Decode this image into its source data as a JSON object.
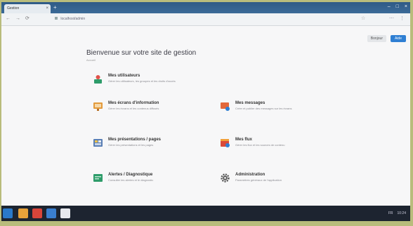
{
  "browser": {
    "tab_label": "Gestion",
    "tab_close": "×",
    "new_tab": "+",
    "window_controls": [
      "–",
      "□",
      "×"
    ],
    "nav": [
      "←",
      "→",
      "⟳"
    ],
    "url": "localhost/admin",
    "star": "☆",
    "addr_right": [
      "⋯",
      "⋮"
    ]
  },
  "header": {
    "buttons": [
      "Bonjour",
      "Aide"
    ]
  },
  "page": {
    "title": "Bienvenue sur votre site de gestion",
    "subtitle": "Accueil"
  },
  "cards": [
    {
      "title": "Mes utilisateurs",
      "desc": "Gérer les utilisateurs, les groupes et les droits d'accès",
      "icon": "user-icon",
      "color": "#2e9c6a"
    },
    {
      "title": "Mes écrans d'information",
      "desc": "Gérer les écrans et les contenus diffusés",
      "icon": "screen-icon",
      "color": "#e39a3b"
    },
    {
      "title": "Mes messages",
      "desc": "Créer et publier des messages sur les écrans",
      "icon": "message-icon",
      "color": "#e3683b"
    },
    {
      "title": "Mes présentations / pages",
      "desc": "Gérer les présentations et les pages",
      "icon": "presentation-icon",
      "color": "#5a7fb5"
    },
    {
      "title": "Mes flux",
      "desc": "Gérer les flux et les sources de contenu",
      "icon": "feed-icon",
      "color": "#d94a3a"
    },
    {
      "title": "Alertes / Diagnostique",
      "desc": "Consulter les alertes et le diagnostic",
      "icon": "alert-icon",
      "color": "#2e9c6a"
    },
    {
      "title": "Administration",
      "desc": "Paramètres généraux de l'application",
      "icon": "gear-icon",
      "color": "#555555"
    }
  ],
  "taskbar": {
    "tray": [
      "FR",
      "10:24"
    ]
  }
}
